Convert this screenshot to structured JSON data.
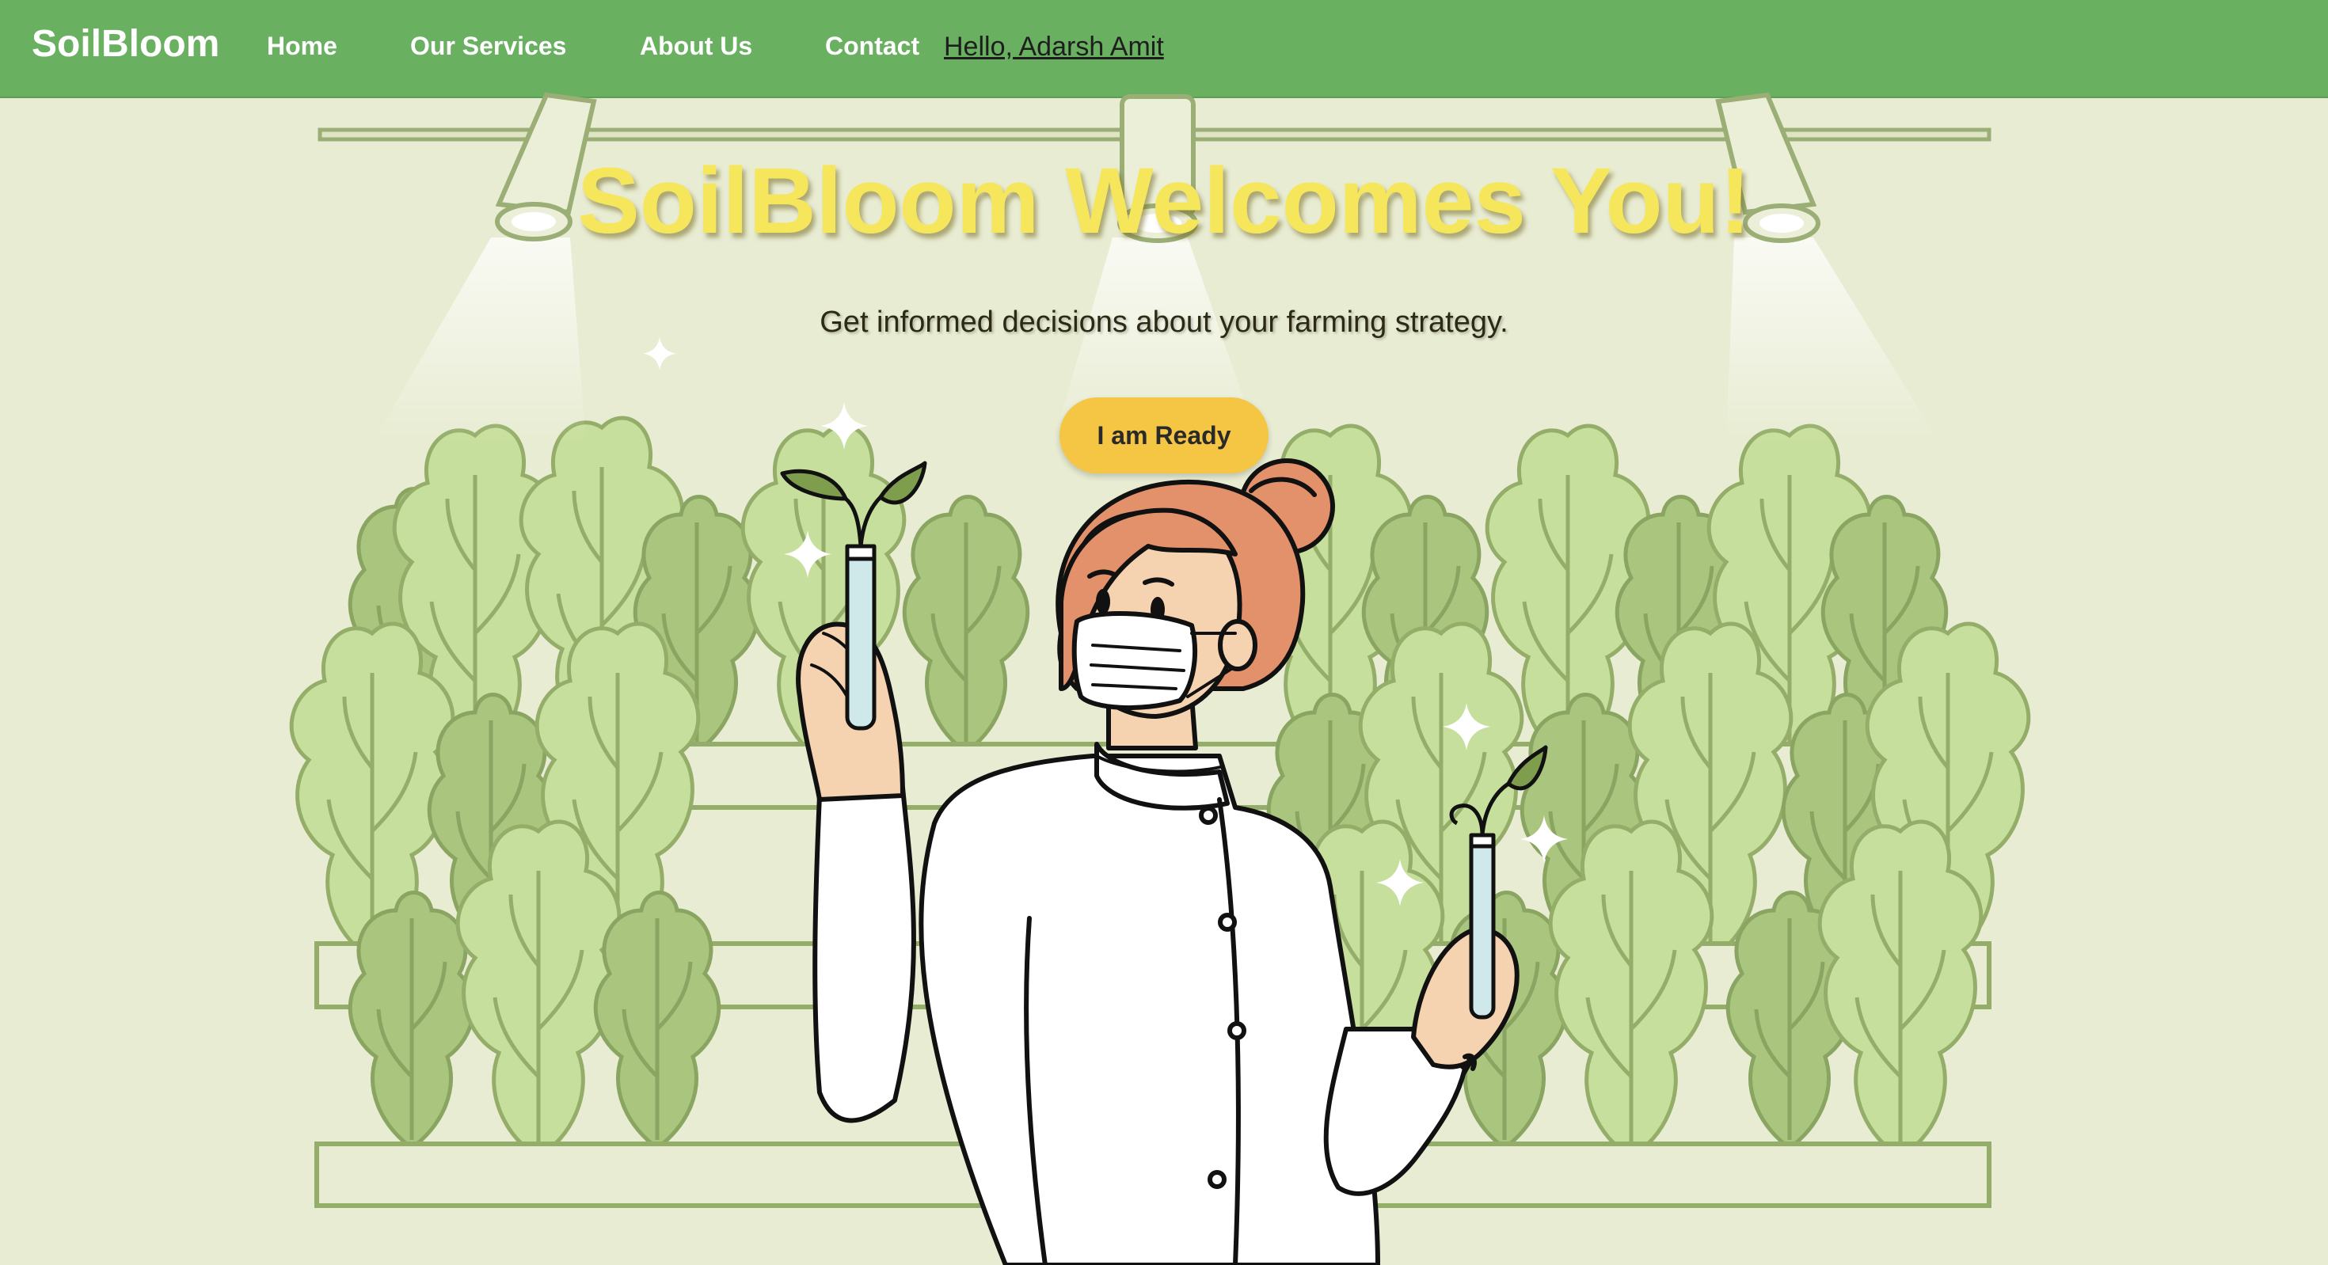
{
  "nav": {
    "brand": "SoilBloom",
    "links": [
      "Home",
      "Our Services",
      "About Us",
      "Contact"
    ],
    "greeting": "Hello, Adarsh Amit"
  },
  "hero": {
    "title": "SoilBloom Welcomes You!",
    "subtitle": "Get informed decisions about your farming strategy.",
    "cta_label": "I am Ready"
  },
  "colors": {
    "navbar": "#69b060",
    "background": "#e8ecd2",
    "title": "#f6e65b",
    "button": "#f5c544",
    "leaf_light": "#c7df9c",
    "leaf_mid": "#a9c47c",
    "hair": "#e2916a"
  },
  "illustration": {
    "icons": [
      "track-light-icon",
      "plant-shelf-icon",
      "scientist-illustration",
      "test-tube-sprout-icon",
      "sparkle-icon"
    ]
  }
}
